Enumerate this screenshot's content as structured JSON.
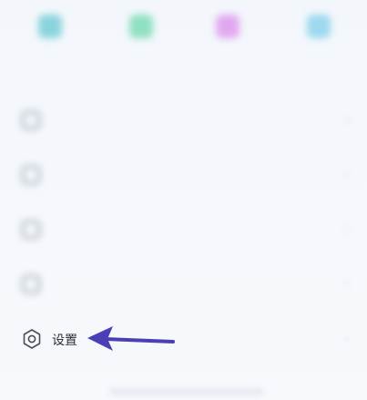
{
  "shortcuts": [
    {
      "label": "",
      "color": "#8ad4dc"
    },
    {
      "label": "",
      "color": "#8fe0c0"
    },
    {
      "label": "",
      "color": "#e2a8ef"
    },
    {
      "label": "",
      "color": "#9cd8ee"
    }
  ],
  "menu_rows": [
    {
      "label": "",
      "badge": "",
      "icon": "square-icon"
    },
    {
      "label": "",
      "badge": "",
      "icon": "square-icon"
    },
    {
      "label": "",
      "badge": "",
      "icon": "square-icon"
    },
    {
      "label": "",
      "badge": "",
      "icon": "square-icon"
    }
  ],
  "settings": {
    "label": "设置",
    "icon": "hexagon-gear-icon",
    "chevron": "›"
  },
  "annotation": {
    "color": "#4b3fb5"
  }
}
